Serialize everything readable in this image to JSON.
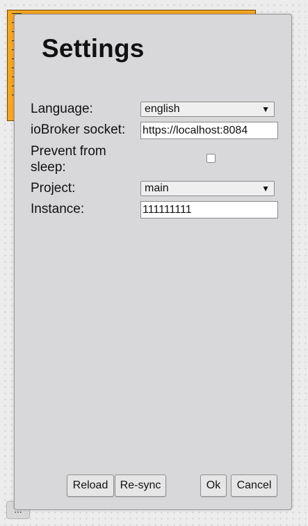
{
  "background": {
    "widget_color": "#f5a623",
    "more_button_label": "..."
  },
  "dialog": {
    "title": "Settings",
    "fields": {
      "language": {
        "label": "Language:",
        "selected": "english"
      },
      "socket": {
        "label": "ioBroker socket:",
        "value": "https://localhost:8084"
      },
      "prevent_sleep": {
        "label_line1": "Prevent from",
        "label_line2": "sleep:",
        "checked": false
      },
      "project": {
        "label": "Project:",
        "selected": "main"
      },
      "instance": {
        "label": "Instance:",
        "value": "111111111"
      }
    },
    "buttons": {
      "reload": "Reload",
      "resync": "Re-sync",
      "ok": "Ok",
      "cancel": "Cancel"
    },
    "dropdown_arrow_glyph": "▼"
  }
}
